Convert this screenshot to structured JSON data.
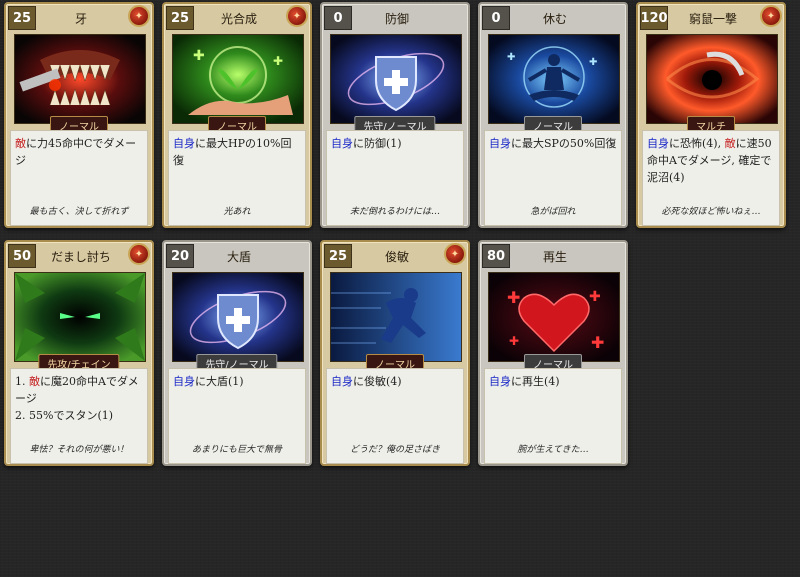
{
  "cards": [
    {
      "cost": "25",
      "title": "牙",
      "badge": "ノーマル",
      "desc_pre": "",
      "desc_hl": "敵",
      "desc_post": "に力45命中Cでダメージ",
      "flavor": "最も古く、決して折れず"
    },
    {
      "cost": "25",
      "title": "光合成",
      "badge": "ノーマル",
      "desc_pre": "",
      "desc_hl": "自身",
      "desc_post": "に最大HPの10%回復",
      "flavor": "光あれ"
    },
    {
      "cost": "0",
      "title": "防御",
      "badge": "先守/ノーマル",
      "desc_pre": "",
      "desc_hl": "自身",
      "desc_post": "に防御(1)",
      "flavor": "未だ倒れるわけには…"
    },
    {
      "cost": "0",
      "title": "休む",
      "badge": "ノーマル",
      "desc_pre": "",
      "desc_hl": "自身",
      "desc_post": "に最大SPの50%回復",
      "flavor": "急がば回れ"
    },
    {
      "cost": "120",
      "title": "窮鼠一撃",
      "badge": "マルチ",
      "desc_hl1": "自身",
      "desc_mid1": "に恐怖(4), ",
      "desc_hl2": "敵",
      "desc_post2": "に速50命中Aでダメージ, 確定で泥沼(4)",
      "flavor": "必死な奴ほど怖いねぇ…"
    },
    {
      "cost": "50",
      "title": "だまし討ち",
      "badge": "先攻/チェイン",
      "line1_pre": "1. ",
      "line1_hl": "敵",
      "line1_post": "に魔20命中Aでダメージ",
      "line2": "2. 55%でスタン(1)",
      "flavor": "卑怯？それの何が悪い！"
    },
    {
      "cost": "20",
      "title": "大盾",
      "badge": "先守/ノーマル",
      "desc_pre": "",
      "desc_hl": "自身",
      "desc_post": "に大盾(1)",
      "flavor": "あまりにも巨大で無骨"
    },
    {
      "cost": "25",
      "title": "俊敏",
      "badge": "ノーマル",
      "desc_pre": "",
      "desc_hl": "自身",
      "desc_post": "に俊敏(4)",
      "flavor": "どうだ？俺の足さばき"
    },
    {
      "cost": "80",
      "title": "再生",
      "badge": "ノーマル",
      "desc_pre": "",
      "desc_hl": "自身",
      "desc_post": "に再生(4)",
      "flavor": "腕が生えてきた…"
    }
  ]
}
